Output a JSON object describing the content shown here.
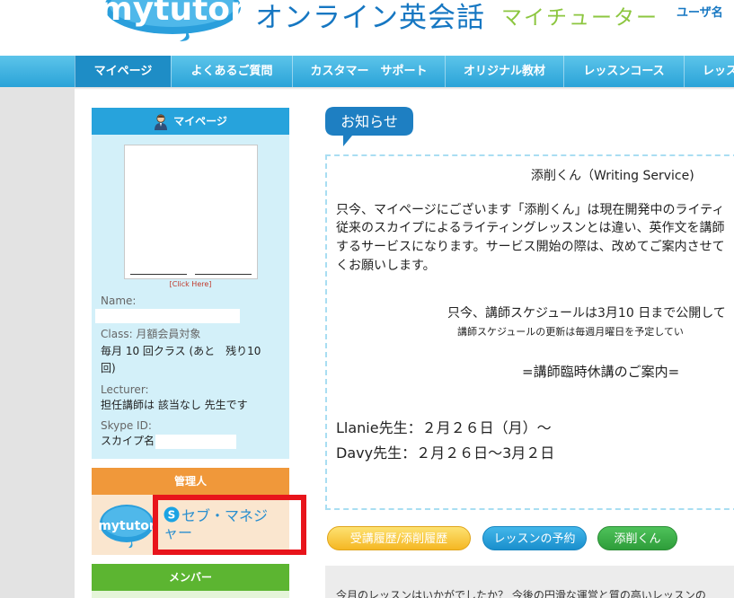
{
  "header": {
    "logo_text": "mytutor",
    "title": "オンライン英会話",
    "subtitle": "マイチューター",
    "user_label": "ユーザ名"
  },
  "nav": {
    "items": [
      {
        "label": "マイページ",
        "active": true
      },
      {
        "label": "よくあるご質問"
      },
      {
        "label": "カスタマー　サポート"
      },
      {
        "label": "オリジナル教材"
      },
      {
        "label": "レッスンコース"
      },
      {
        "label": "レッスン"
      }
    ]
  },
  "sidebar": {
    "mypage": {
      "title": "マイページ",
      "click_here": "[Click Here]",
      "name_label": "Name:",
      "class_label": "Class: 月額会員対象",
      "class_line1": "毎月 10 回クラス (あと　残り10",
      "class_line2": "回)",
      "lecturer_label": "Lecturer:",
      "lecturer_value": "担任講師は 該当なし 先生です",
      "skype_label": "Skype ID:",
      "skype_value": "スカイプ名"
    },
    "admin": {
      "title": "管理人",
      "logo_text": "mytutor",
      "manager_line1": "セブ・マネジ",
      "manager_line2": "ャー"
    },
    "member": {
      "title": "メンバー"
    }
  },
  "main": {
    "badge": "お知らせ",
    "notice": {
      "heading": "添削くん（Writing Service)",
      "para_line1": "只今、マイページにございます「添削くん」は現在開発中のライティ",
      "para_line2": "従来のスカイプによるライティングレッスンとは違い、英作文を講師",
      "para_line3": "するサービスになります。サービス開始の際は、改めてご案内させて",
      "para_line4": "くお願いします。",
      "schedule_line1": "只今、講師スケジュールは3月10 日まで公開して",
      "schedule_line2": "講師スケジュールの更新は毎週月曜日を予定してい",
      "holiday_title": "=講師臨時休講のご案内=",
      "holiday_1": "Llanie先生：２月２６日（月）～",
      "holiday_2": "Davy先生：２月２６日～3月２日"
    },
    "buttons": {
      "history": "受講履歴/添削履歴",
      "reserve": "レッスンの予約",
      "tensaku": "添削くん"
    },
    "bottom_text": "今月のレッスンはいかがでしたか？ 今後の円滑な運営と質の高いレッスンの"
  }
}
